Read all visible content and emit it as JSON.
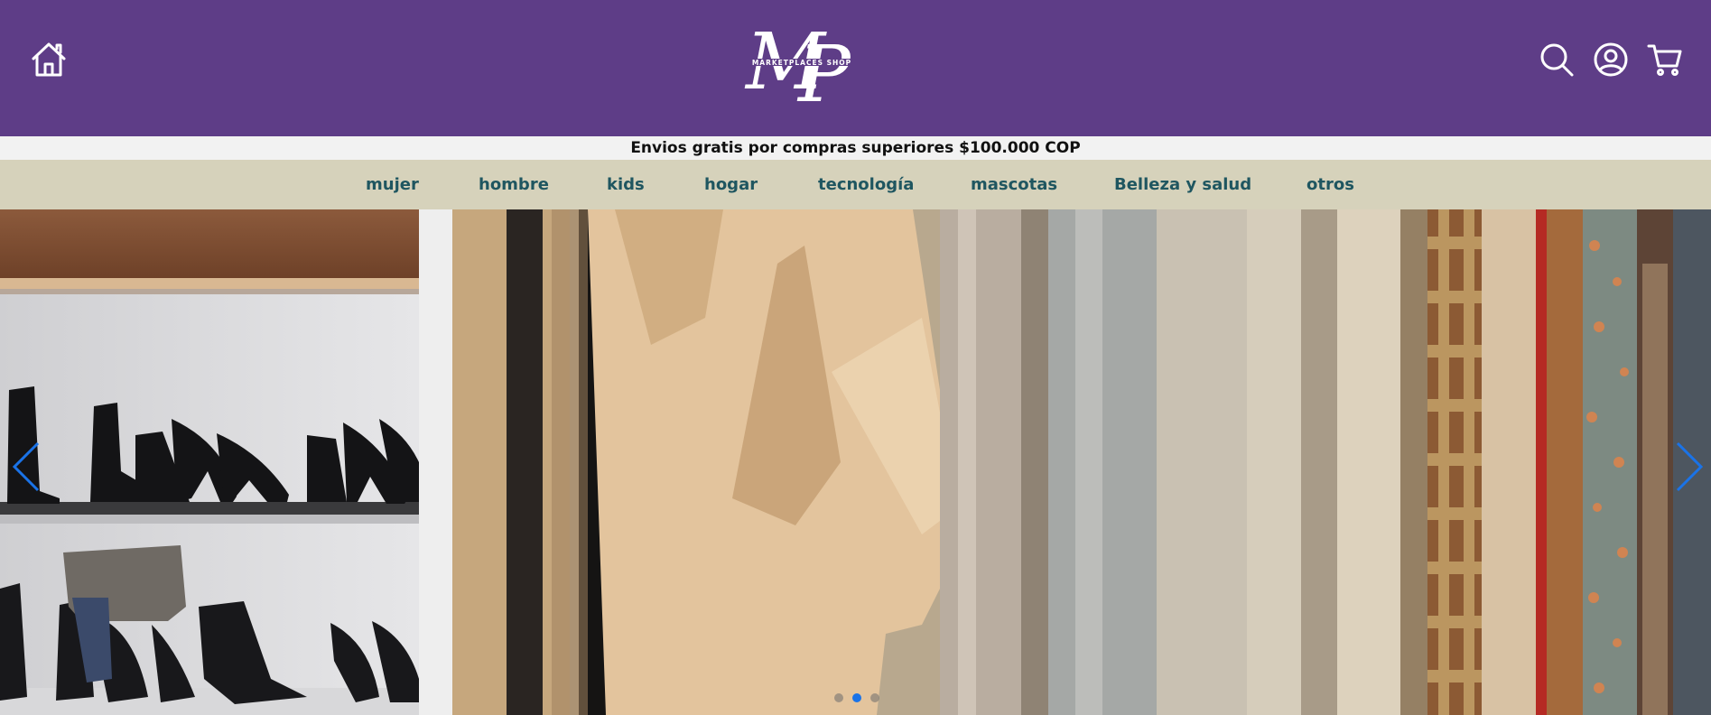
{
  "header": {
    "logo_monogram": "MP",
    "logo_text": "MARKETPLACES SHOP",
    "icons": [
      "home-icon",
      "search-icon",
      "user-account-icon",
      "shopping-cart-icon"
    ]
  },
  "announcement": "Envios gratis por compras superiores $100.000 COP",
  "nav": {
    "items": [
      {
        "label": "mujer"
      },
      {
        "label": "hombre"
      },
      {
        "label": "kids"
      },
      {
        "label": "hogar"
      },
      {
        "label": "tecnología"
      },
      {
        "label": "mascotas"
      },
      {
        "label": "Belleza y salud"
      },
      {
        "label": "otros"
      }
    ]
  },
  "carousel": {
    "slide_count": 3,
    "active_slide": 2,
    "slides": [
      {
        "image": "shoe-shelf-image"
      },
      {
        "image": "clothing-rack-image"
      }
    ]
  },
  "colors": {
    "header_bg": "#5e3d87",
    "announce_bg": "#f2f2f2",
    "nav_bg": "#d6d2bb",
    "nav_text": "#1f5660",
    "arrow": "#1a73e8"
  }
}
